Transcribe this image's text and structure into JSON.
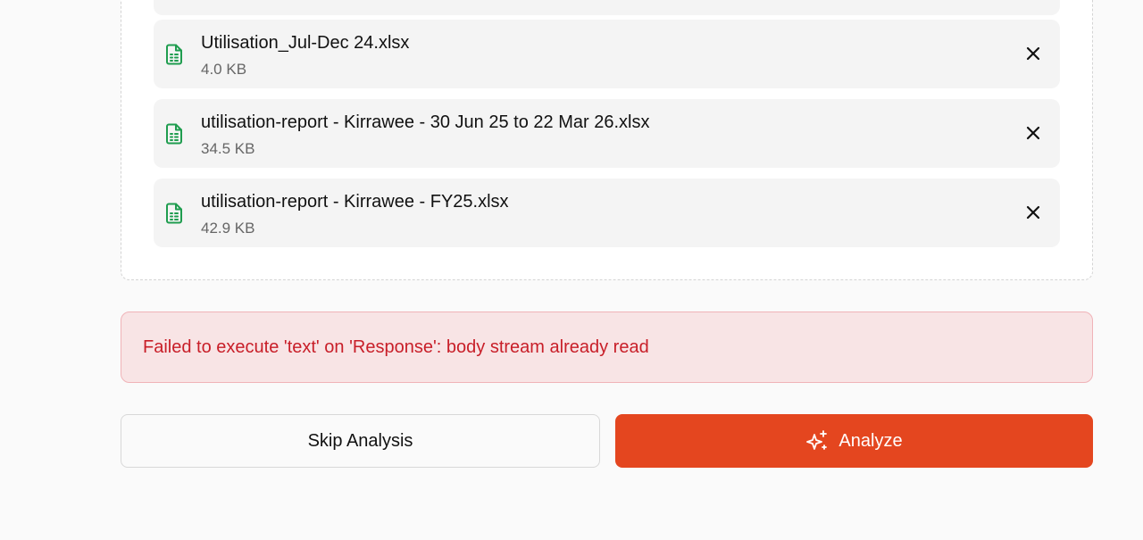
{
  "files": [
    {
      "name": "Utilisation_Jul-Dec 24.xlsx",
      "size": "4.0 KB"
    },
    {
      "name": "utilisation-report - Kirrawee - 30 Jun 25 to 22 Mar 26.xlsx",
      "size": "34.5 KB"
    },
    {
      "name": "utilisation-report - Kirrawee - FY25.xlsx",
      "size": "42.9 KB"
    }
  ],
  "file_icon": "spreadsheet-file-icon",
  "remove_icon": "close-icon",
  "error": {
    "message": "Failed to execute 'text' on 'Response': body stream already read"
  },
  "actions": {
    "skip_label": "Skip Analysis",
    "analyze_label": "Analyze",
    "analyze_icon": "sparkles-icon"
  },
  "colors": {
    "accent": "#e4461f",
    "file_icon": "#1f9d4f",
    "error_text": "#c81e28",
    "error_bg": "#f8e4e5",
    "error_border": "#f0b3b8"
  }
}
